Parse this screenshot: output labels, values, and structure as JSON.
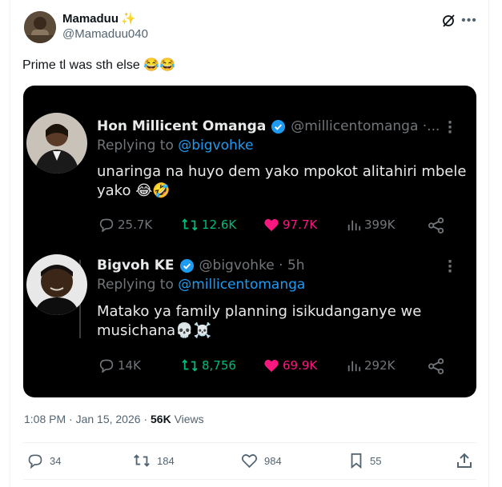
{
  "author": {
    "display_name": "Mamaduu",
    "name_emoji": "✨",
    "handle": "@Mamaduu040"
  },
  "tweet": {
    "text": "Prime tl was sth else 😂😂",
    "time": "1:08 PM · Jan 15, 2026",
    "views_count": "56K",
    "views_label": "Views"
  },
  "embedded": {
    "tweet1": {
      "name": "Hon Millicent Omanga",
      "handle": "@millicentomanga ·...",
      "replying_prefix": "Replying to",
      "replying_to": "@bigvohke",
      "text": "unaringa na huyo dem yako mpokot alitahiri mbele yako 😂🤣",
      "replies": "25.7K",
      "retweets": "12.6K",
      "likes": "97.7K",
      "views": "399K"
    },
    "tweet2": {
      "name": "Bigvoh KE",
      "handle": "@bigvohke · 5h",
      "replying_prefix": "Replying to",
      "replying_to": "@millicentomanga",
      "text": "Matako ya family planning isikudanganye we musichana💀☠️",
      "replies": "14K",
      "retweets": "8,756",
      "likes": "69.9K",
      "views": "292K"
    }
  },
  "actions": {
    "replies": "34",
    "reposts": "184",
    "likes": "984",
    "bookmarks": "55"
  },
  "colors": {
    "verified": "#1d9bf0",
    "repost_green": "#00ba7c",
    "like_pink": "#f91880",
    "media_bg": "#000000"
  },
  "icons": [
    "grok-icon",
    "more-icon",
    "verified-icon",
    "reply-icon",
    "repost-icon",
    "like-icon",
    "views-icon",
    "share-icon",
    "bookmark-icon"
  ]
}
